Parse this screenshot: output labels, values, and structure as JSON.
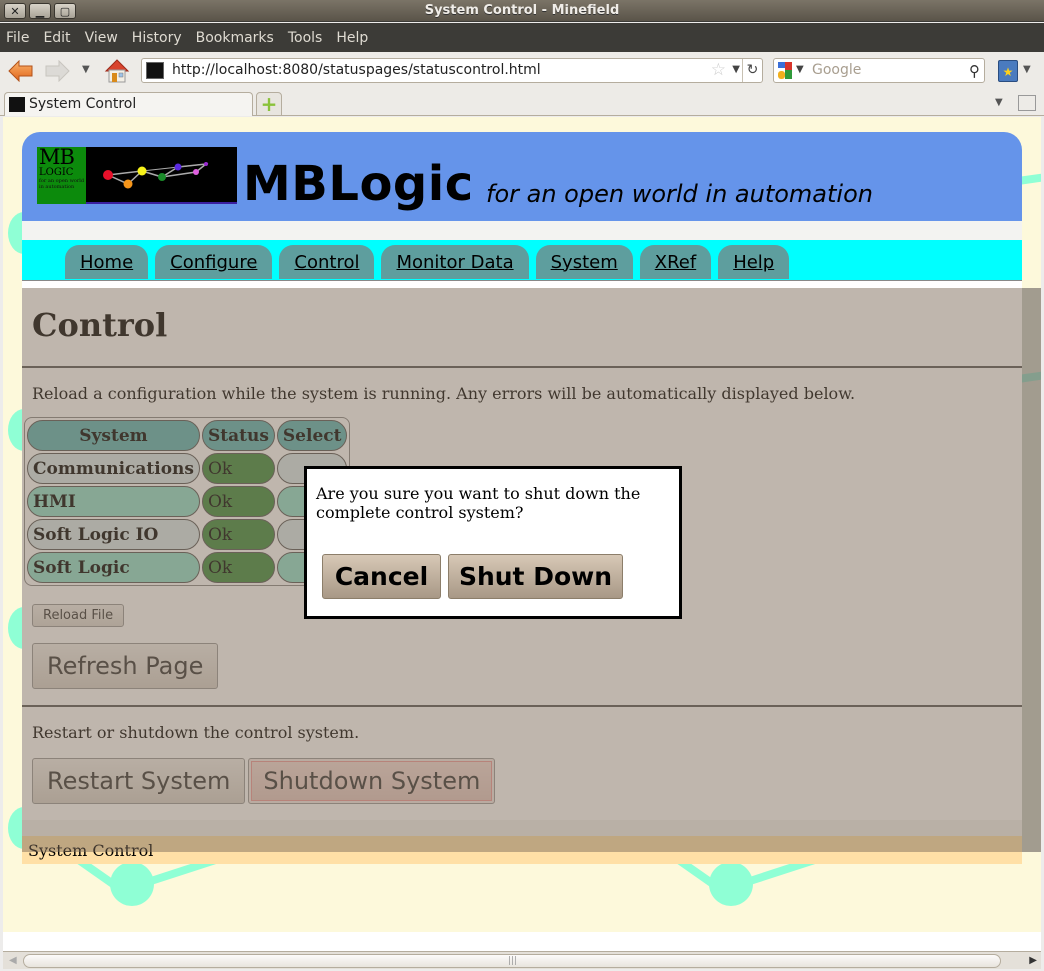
{
  "window": {
    "title": "System Control - Minefield",
    "buttons": [
      "close",
      "minimize",
      "maximize"
    ]
  },
  "menubar": {
    "items": [
      {
        "label": "File",
        "accel": "F"
      },
      {
        "label": "Edit",
        "accel": "E"
      },
      {
        "label": "View",
        "accel": "V"
      },
      {
        "label": "History",
        "accel": "s"
      },
      {
        "label": "Bookmarks",
        "accel": "B"
      },
      {
        "label": "Tools",
        "accel": "T"
      },
      {
        "label": "Help",
        "accel": "H"
      }
    ]
  },
  "toolbar": {
    "url": "http://localhost:8080/statuspages/statuscontrol.html",
    "search_placeholder": "Google",
    "icons": [
      "back-icon",
      "forward-icon",
      "history-dropdown-icon",
      "home-icon",
      "bookmark-star-icon",
      "reload-icon",
      "search-engine-icon",
      "magnifier-icon",
      "bookmarks-sidebar-icon"
    ]
  },
  "tabs": [
    {
      "label": "System Control",
      "active": true
    }
  ],
  "page": {
    "header": {
      "site_title": "MBLogic",
      "tagline": "for an open world in automation",
      "logo_text_big": "MB",
      "logo_text_mid": "LOGIC",
      "logo_text_small": "for an open world in automation"
    },
    "nav": [
      "Home",
      "Configure",
      "Control",
      "Monitor Data",
      "System",
      "XRef",
      "Help"
    ],
    "heading": "Control",
    "reload_description": "Reload a configuration while the system is running. Any errors will be automatically displayed below.",
    "status_table": {
      "headers": [
        "System",
        "Status",
        "Select"
      ],
      "rows": [
        {
          "system": "Communications",
          "status": "Ok",
          "has_checkbox": false,
          "checked": false
        },
        {
          "system": "HMI",
          "status": "Ok",
          "has_checkbox": true,
          "checked": false
        },
        {
          "system": "Soft Logic IO",
          "status": "Ok",
          "has_checkbox": true,
          "checked": false
        },
        {
          "system": "Soft Logic",
          "status": "Ok",
          "has_checkbox": true,
          "checked": false
        }
      ]
    },
    "reload_file_button": "Reload File",
    "refresh_button": "Refresh Page",
    "restart_description": "Restart or shutdown the control system.",
    "restart_button": "Restart System",
    "shutdown_button": "Shutdown System",
    "footer": "System Control"
  },
  "dialog": {
    "message": "Are you sure you want to shut down the complete control system?",
    "cancel_label": "Cancel",
    "confirm_label": "Shut Down"
  },
  "colors": {
    "header_bg": "#6594ea",
    "nav_bg": "#00ffff",
    "nav_tab": "#5e9e9e",
    "status_ok": "#3b8a3b",
    "footer_bg": "#ffe0a6",
    "page_bg": "#fdf9db"
  }
}
